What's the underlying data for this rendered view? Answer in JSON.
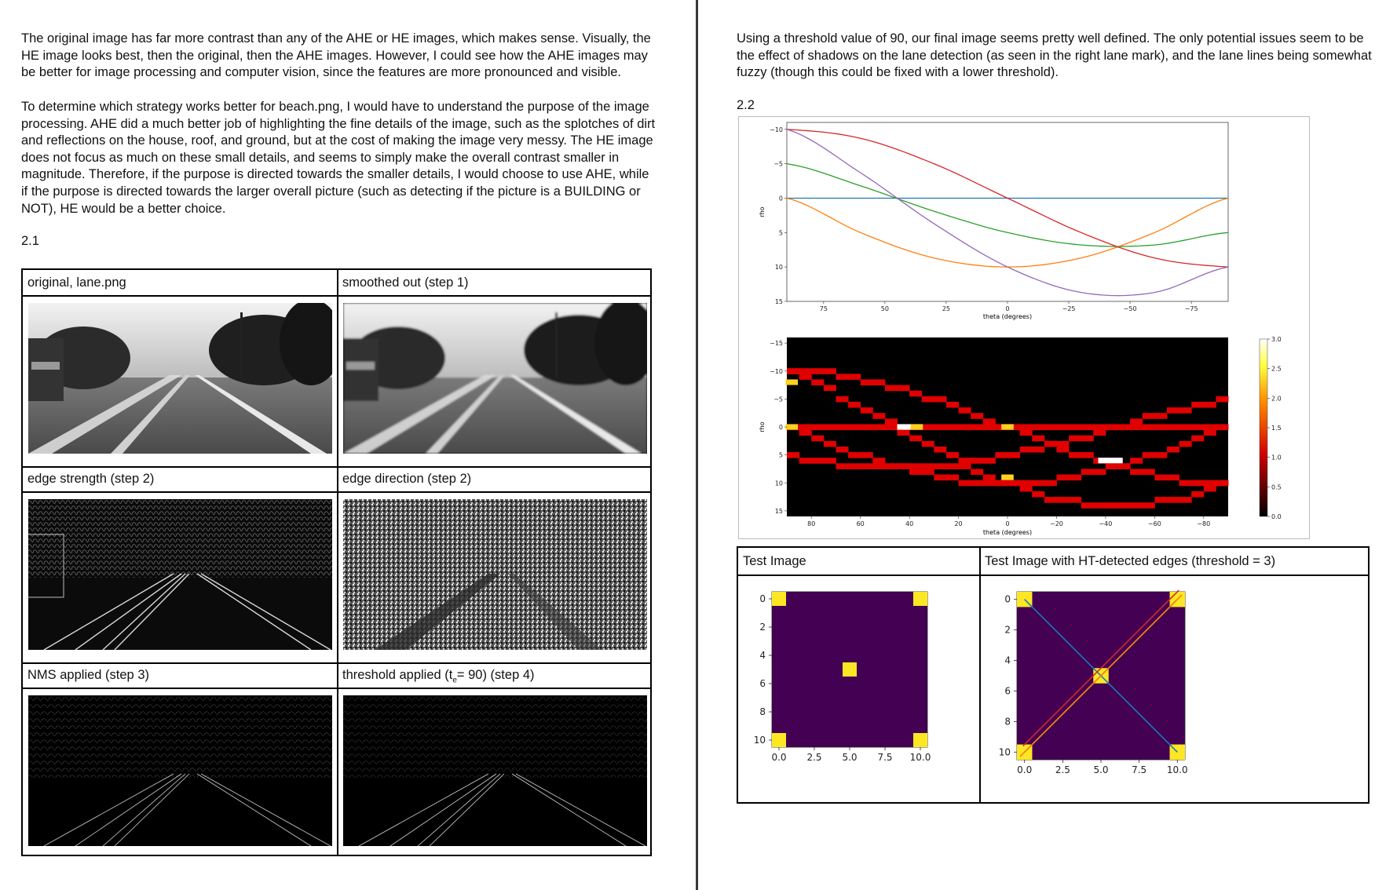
{
  "left_page": {
    "paragraph1": "The original image has far more contrast than any of the AHE or HE images, which makes sense. Visually, the HE image looks best, then the original, then the AHE images. However, I could see how the AHE images may be better for image processing and computer vision, since the features are more pronounced and visible.",
    "paragraph2": "To determine which strategy works better for beach.png, I would have to understand the purpose of the image processing. AHE did a much better job of highlighting the fine details of the image, such as the splotches of dirt and reflections on the house, roof, and ground, but at the cost of making the image very messy. The HE image does not focus as much on these small details, and seems to simply make the overall contrast smaller in magnitude. Therefore, if the purpose is directed towards the smaller details, I would choose to use AHE, while if the purpose is directed towards the larger overall picture (such as detecting if the picture is a BUILDING or NOT), HE would be a better choice.",
    "section_heading": "2.1",
    "grid": {
      "c1": "original, lane.png",
      "c2": "smoothed out (step 1)",
      "c3": "edge strength (step 2)",
      "c4": "edge direction (step 2)",
      "c5": "NMS applied (step 3)",
      "c6_prefix": "threshold applied (t",
      "c6_sub": "e",
      "c6_suffix": "= 90) (step 4)"
    }
  },
  "right_page": {
    "paragraph1": "Using a threshold value of 90, our final image seems pretty well defined. The only potential issues seem to be the effect of shadows on the lane detection (as seen in the right lane mark), and the lane lines being somewhat fuzzy (though this could be fixed with a lower threshold).",
    "section_heading": "2.2",
    "test_table": {
      "left_header": "Test Image",
      "right_header": "Test Image with HT-detected edges (threshold = 3)"
    }
  },
  "chart_data": [
    {
      "type": "line",
      "xlabel": "theta (degrees)",
      "ylabel": "rho",
      "x_ticks": [
        "75",
        "50",
        "25",
        "0",
        "−25",
        "−50",
        "−75"
      ],
      "y_ticks": [
        "−10",
        "−5",
        "0",
        "5",
        "10",
        "15"
      ],
      "xlim": [
        90,
        -90
      ],
      "ylim": [
        -11,
        15
      ],
      "series": [
        {
          "color": "#1f77b4",
          "x": [
            90,
            45,
            0,
            -45,
            -90
          ],
          "y": [
            0,
            0,
            0,
            0,
            0
          ]
        },
        {
          "color": "#ff7f0e",
          "x": [
            90,
            60,
            30,
            0,
            -30,
            -60,
            -90
          ],
          "y": [
            0,
            5,
            8.7,
            10,
            8.7,
            5,
            0
          ]
        },
        {
          "color": "#2ca02c",
          "x": [
            90,
            60,
            30,
            0,
            -30,
            -60,
            -90
          ],
          "y": [
            -5,
            -1.8,
            1.9,
            5,
            6.8,
            6.8,
            5
          ]
        },
        {
          "color": "#d62728",
          "x": [
            90,
            60,
            30,
            0,
            -30,
            -60,
            -90
          ],
          "y": [
            -10,
            -8.7,
            -5,
            0,
            5,
            8.7,
            10
          ]
        },
        {
          "color": "#9467bd",
          "x": [
            90,
            60,
            30,
            0,
            -30,
            -60,
            -90
          ],
          "y": [
            -10,
            -3.7,
            3.7,
            10,
            13.7,
            13.7,
            10
          ]
        }
      ]
    },
    {
      "type": "heatmap",
      "xlabel": "theta (degrees)",
      "ylabel": "rho",
      "x_ticks": [
        "80",
        "60",
        "40",
        "20",
        "0",
        "−20",
        "−40",
        "−60",
        "−80"
      ],
      "y_ticks": [
        "−15",
        "−10",
        "−5",
        "0",
        "5",
        "10",
        "15"
      ],
      "xlim": [
        90,
        -90
      ],
      "ylim": [
        -16,
        16
      ],
      "colorbar_ticks": [
        "3.0",
        "2.5",
        "2.0",
        "1.5",
        "1.0",
        "0.5",
        "0.0"
      ],
      "colorbar_range": [
        0,
        3
      ]
    },
    {
      "type": "image",
      "x_ticks": [
        "0.0",
        "2.5",
        "5.0",
        "7.5",
        "10.0"
      ],
      "y_ticks": [
        "0",
        "2",
        "4",
        "6",
        "8",
        "10"
      ],
      "bright_cells": [
        [
          0,
          0
        ],
        [
          0,
          10
        ],
        [
          5,
          5
        ],
        [
          10,
          0
        ],
        [
          10,
          10
        ]
      ]
    },
    {
      "type": "image",
      "x_ticks": [
        "0.0",
        "2.5",
        "5.0",
        "7.5",
        "10.0"
      ],
      "y_ticks": [
        "0",
        "2",
        "4",
        "6",
        "8",
        "10"
      ],
      "bright_cells": [
        [
          0,
          0
        ],
        [
          0,
          10
        ],
        [
          5,
          5
        ],
        [
          10,
          0
        ],
        [
          10,
          10
        ]
      ],
      "detected_lines": [
        {
          "color": "#1f77b4",
          "from": [
            0,
            0
          ],
          "to": [
            10,
            10
          ]
        },
        {
          "color": "#2ca02c",
          "from": [
            0,
            10
          ],
          "to": [
            10,
            0
          ]
        },
        {
          "color": "#ff7f0e",
          "from": [
            -0.3,
            10.3
          ],
          "to": [
            10.3,
            -0.3
          ]
        },
        {
          "color": "#d62728",
          "from": [
            -0.1,
            9.6
          ],
          "to": [
            10.1,
            -0.6
          ]
        }
      ]
    }
  ]
}
